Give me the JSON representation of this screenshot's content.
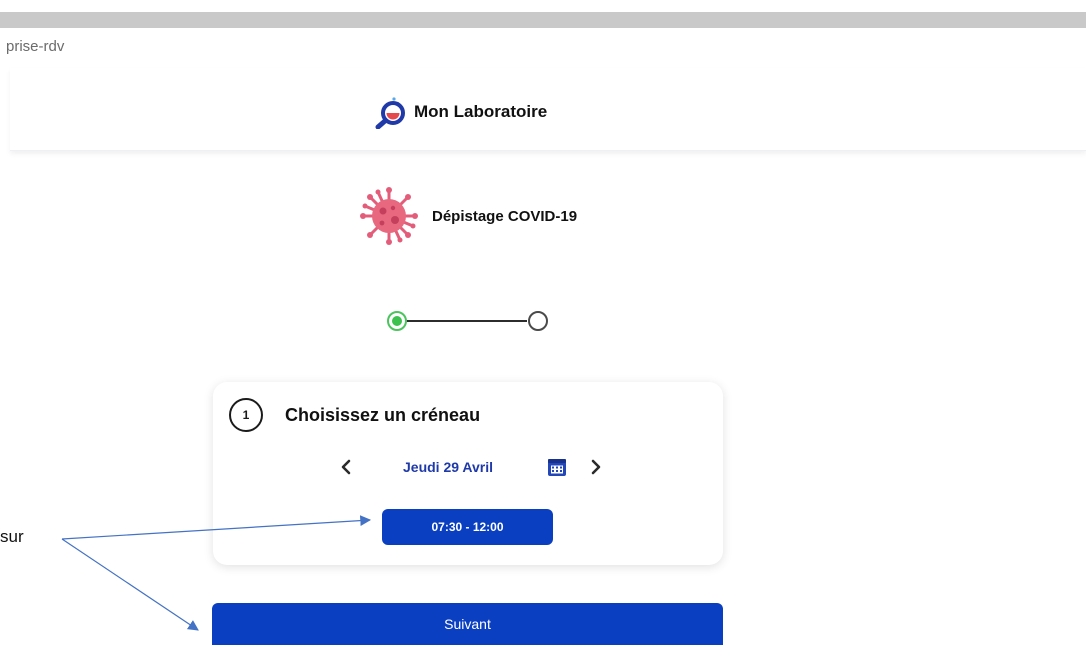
{
  "browser": {
    "url_text": "prise-rdv"
  },
  "header": {
    "brand_name": "Mon Laboratoire",
    "logo_icon": "lab-magnifier-logo-icon",
    "colors": {
      "logo_blue": "#1f3aa8",
      "logo_red": "#e5484d"
    }
  },
  "test": {
    "name": "Dépistage COVID-19",
    "icon": "virus-icon",
    "color": "#e35d7a"
  },
  "stepper": {
    "total_steps": 2,
    "current_step": 1,
    "active_color": "#3cc14f"
  },
  "slot_card": {
    "step_number": "1",
    "title": "Choisissez un créneau",
    "date_label": "Jeudi 29 Avril",
    "prev_icon": "chevron-left-icon",
    "next_icon": "chevron-right-icon",
    "calendar_icon": "calendar-icon",
    "slot_label": "07:30 - 12:00"
  },
  "actions": {
    "next_label": "Suivant",
    "primary_color": "#0b3fc2"
  },
  "annotation": {
    "text": "sur"
  }
}
